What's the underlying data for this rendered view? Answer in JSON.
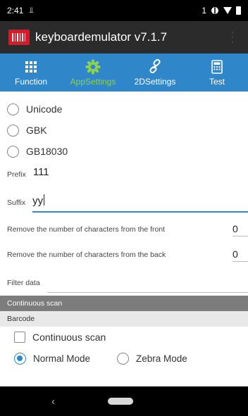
{
  "status_bar": {
    "time": "2:41",
    "notification": "⫫",
    "sim_indicator": "1"
  },
  "app_bar": {
    "title": "keyboardemulator v7.1.7",
    "overflow_icon": "⋮"
  },
  "tabs": [
    {
      "label": "Function",
      "icon": "grid-icon",
      "active": false
    },
    {
      "label": "AppSettings",
      "icon": "gear-icon",
      "active": true
    },
    {
      "label": "2DSettings",
      "icon": "link-icon",
      "active": false
    },
    {
      "label": "Test",
      "icon": "calculator-icon",
      "active": false
    }
  ],
  "encoding": {
    "options": [
      {
        "label": "Unicode",
        "selected": false
      },
      {
        "label": "GBK",
        "selected": false
      },
      {
        "label": "GB18030",
        "selected": false
      }
    ]
  },
  "prefix": {
    "label": "Prefix",
    "value": "111"
  },
  "suffix": {
    "label": "Suffix",
    "value": "yy"
  },
  "remove_front": {
    "label": "Remove the number of characters from the front",
    "value": "0"
  },
  "remove_back": {
    "label": "Remove the number of characters from the back",
    "value": "0"
  },
  "filter": {
    "label": "Filter data",
    "value": ""
  },
  "sections": {
    "continuous_scan": "Continuous scan",
    "barcode": "Barcode"
  },
  "continuous_scan_checkbox": {
    "label": "Continuous scan",
    "checked": false
  },
  "modes": [
    {
      "label": "Normal Mode",
      "selected": true
    },
    {
      "label": "Zebra Mode",
      "selected": false
    }
  ],
  "nav_bar": {
    "back_glyph": "‹"
  },
  "colors": {
    "tab_bar": "#2f86c8",
    "active_tab": "#8fd14f",
    "app_bar": "#2b2b2b",
    "logo": "#cf1d2b",
    "section_dark": "#7c7c7c"
  }
}
